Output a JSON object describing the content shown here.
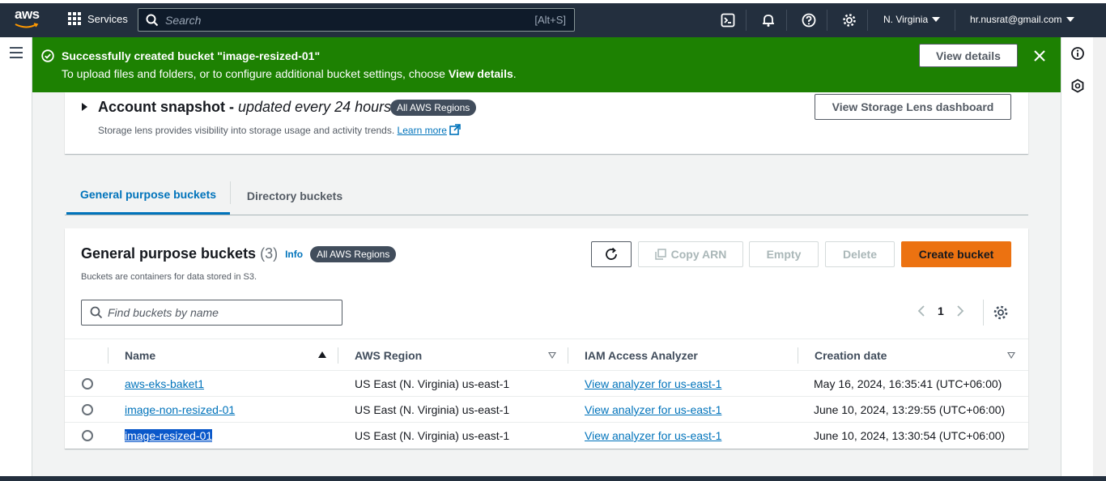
{
  "topnav": {
    "logo_text": "aws",
    "services_label": "Services",
    "search_placeholder": "Search",
    "search_shortcut": "[Alt+S]",
    "region": "N. Virginia",
    "account": "hr.nusrat@gmail.com",
    "icons": [
      "cloudshell-icon",
      "bell-icon",
      "help-icon",
      "gear-icon"
    ]
  },
  "flash": {
    "title": "Successfully created bucket \"image-resized-01\"",
    "message_prefix": "To upload files and folders, or to configure additional bucket settings, choose ",
    "message_bold": "View details",
    "message_suffix": ".",
    "view_details_label": "View details",
    "color": "#1d8102"
  },
  "snapshot": {
    "title": "Account snapshot",
    "separator": " - ",
    "subtitle": "updated every 24 hours",
    "badge": "All AWS Regions",
    "description": "Storage lens provides visibility into storage usage and activity trends.",
    "learn_more": "Learn more",
    "lens_button": "View Storage Lens dashboard"
  },
  "tabs": [
    {
      "label": "General purpose buckets",
      "active": true
    },
    {
      "label": "Directory buckets",
      "active": false
    }
  ],
  "buckets_panel": {
    "title": "General purpose buckets",
    "count": "(3)",
    "info": "Info",
    "badge": "All AWS Regions",
    "description": "Buckets are containers for data stored in S3.",
    "copy_arn": "Copy ARN",
    "empty": "Empty",
    "delete": "Delete",
    "create": "Create bucket",
    "search_placeholder": "Find buckets by name",
    "page": "1",
    "columns": [
      "Name",
      "AWS Region",
      "IAM Access Analyzer",
      "Creation date"
    ],
    "rows": [
      {
        "name": "aws-eks-baket1",
        "region": "US East (N. Virginia) us-east-1",
        "analyzer": "View analyzer for us-east-1",
        "created": "May 16, 2024, 16:35:41 (UTC+06:00)"
      },
      {
        "name": "image-non-resized-01",
        "region": "US East (N. Virginia) us-east-1",
        "analyzer": "View analyzer for us-east-1",
        "created": "June 10, 2024, 13:29:55 (UTC+06:00)"
      },
      {
        "name": "image-resized-01",
        "region": "US East (N. Virginia) us-east-1",
        "analyzer": "View analyzer for us-east-1",
        "created": "June 10, 2024, 13:30:54 (UTC+06:00)"
      }
    ]
  },
  "colors": {
    "topnav": "#232f3e",
    "success": "#1d8102",
    "link": "#0073bb",
    "primary_button": "#ec7211"
  }
}
